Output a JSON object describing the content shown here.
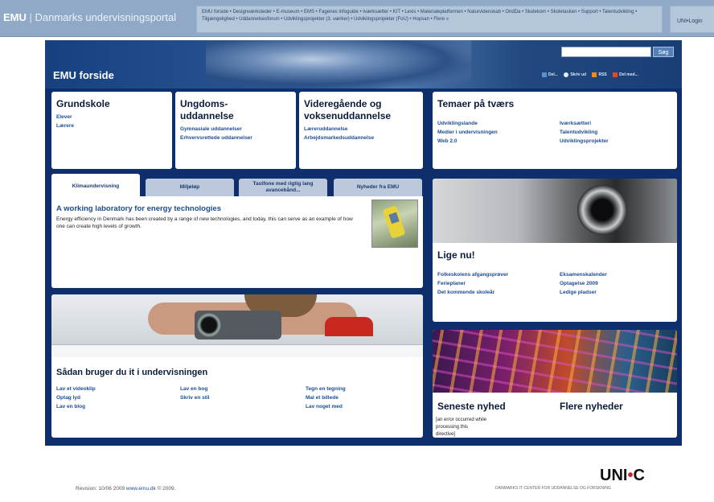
{
  "topbar": {
    "brand_bold": "EMU",
    "brand_sep": " | ",
    "brand_rest": "Danmarks undervisningsportal",
    "links_text": "EMU forside • Designværksteder • E-museum • EMS • Fagenes infoguide • Iværksætter • KIT • Lexis • Materialeplatformen • Naturvidenskab • OndDa • Skolekom • Skoletasken • Support • Talentudvikling • Tilgængelighed • Uddannelsesforum • Udviklingsprojekter (3. værker) • Udviklingsprojekter (FoU) • Hopsan • Flere »",
    "unilogin": "UNI•Login"
  },
  "header": {
    "title": "EMU forside",
    "search_button": "Søg",
    "tools": [
      "Del...",
      "Skriv ud",
      "RSS",
      "Del med..."
    ]
  },
  "boxes": {
    "grundskole": {
      "title": "Grundskole",
      "links": [
        "Elever",
        "Lærere"
      ]
    },
    "ungdom": {
      "title_line1": "Ungdoms-",
      "title_line2": "uddannelse",
      "links": [
        "Gymnasiale uddannelser",
        "Erhvervsrettede uddannelser"
      ]
    },
    "videre": {
      "title_line1": "Videregående og",
      "title_line2": "voksenuddannelse",
      "links": [
        "Læreruddannelse",
        "Arbejdsmarkedsuddannelse"
      ]
    },
    "temaer": {
      "title": "Temaer på tværs",
      "col1": [
        "Udviklingslande",
        "Medier i undervisningen",
        "Web 2.0"
      ],
      "col2": [
        "Iværksætteri",
        "Talentudvikling",
        "Udviklingsprojekter"
      ]
    }
  },
  "tabs": [
    "Klimaundervisning",
    "Miljøløp",
    "Tastfone med rigtig lang avancebånd...",
    "Nyheder fra EMU"
  ],
  "feature": {
    "headline": "A working laboratory for energy technologies",
    "body": "Energy efficiency in Denmark has been created by a range of new technologies, and today, this can serve as an example of how one can create high levels of growth."
  },
  "ligenu": {
    "title": "Lige nu!",
    "col1": [
      "Folkeskolens afgangsprøver",
      "Ferieplaner",
      "Det kommende skoleår"
    ],
    "col2": [
      "Eksamenskalender",
      "Optagelse 2009",
      "Ledige pladser"
    ]
  },
  "saadan": {
    "title": "Sådan bruger du it i undervisningen",
    "col1": [
      "Lav et videoklip",
      "Optag lyd",
      "Lav en blog"
    ],
    "col2": [
      "Lav en bog",
      "Skriv en stil"
    ],
    "col3": [
      "Tegn en tegning",
      "Mal et billede",
      "Lav noget med"
    ]
  },
  "news": {
    "latest_title": "Seneste nyhed",
    "more_title": "Flere nyheder",
    "error": "[an error occurred while processing this directive]"
  },
  "footer": {
    "revision": "Revision: 10/06 2009",
    "site_link": "www.emu.dk",
    "copyright": "© 2009.",
    "logo_a": "UNI",
    "logo_dot": "•",
    "logo_b": "C",
    "logo_sub": "DANMARKS IT-CENTER FOR UDDANNELSE OG FORSKNING"
  },
  "colors": {
    "page_bg": "#0e2f6b",
    "topbar": "#8fa9c6",
    "link": "#1b4c91",
    "accent_red": "#d0202b"
  }
}
